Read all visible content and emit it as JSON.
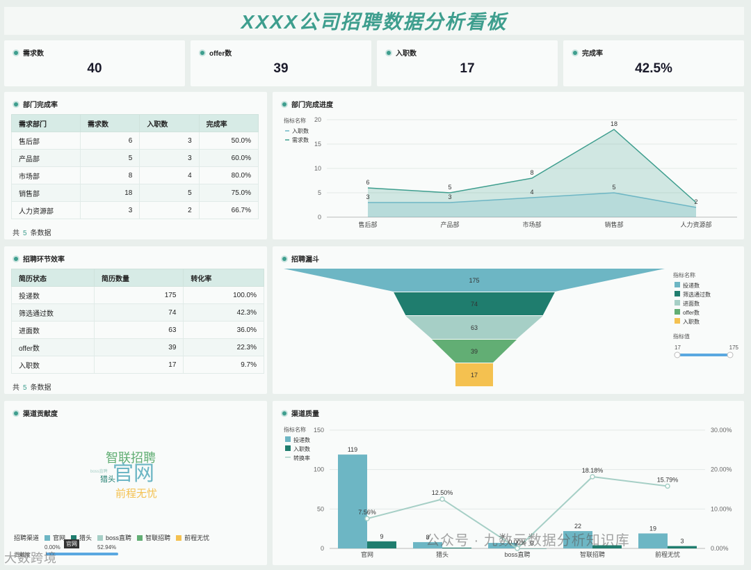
{
  "title": "XXXX公司招聘数据分析看板",
  "kpis": [
    {
      "label": "需求数",
      "value": "40"
    },
    {
      "label": "offer数",
      "value": "39"
    },
    {
      "label": "入职数",
      "value": "17"
    },
    {
      "label": "完成率",
      "value": "42.5%"
    }
  ],
  "dept_table": {
    "title": "部门完成率",
    "headers": [
      "需求部门",
      "需求数",
      "入职数",
      "完成率"
    ],
    "rows": [
      [
        "售后部",
        "6",
        "3",
        "50.0%"
      ],
      [
        "产品部",
        "5",
        "3",
        "60.0%"
      ],
      [
        "市场部",
        "8",
        "4",
        "80.0%"
      ],
      [
        "销售部",
        "18",
        "5",
        "75.0%"
      ],
      [
        "人力资源部",
        "3",
        "2",
        "66.7%"
      ]
    ],
    "footer_prefix": "共",
    "footer_count": "5",
    "footer_suffix": "条数据"
  },
  "stage_table": {
    "title": "招聘环节效率",
    "headers": [
      "简历状态",
      "简历数量",
      "转化率"
    ],
    "rows": [
      [
        "投递数",
        "175",
        "100.0%"
      ],
      [
        "筛选通过数",
        "74",
        "42.3%"
      ],
      [
        "进面数",
        "63",
        "36.0%"
      ],
      [
        "offer数",
        "39",
        "22.3%"
      ],
      [
        "入职数",
        "17",
        "9.7%"
      ]
    ],
    "footer_prefix": "共",
    "footer_count": "5",
    "footer_suffix": "条数据"
  },
  "progress": {
    "title": "部门完成进度",
    "legend_title": "指标名称"
  },
  "funnel": {
    "title": "招聘漏斗",
    "legend_title": "指标名称",
    "range_title": "指标值",
    "range_min": "17",
    "range_max": "175"
  },
  "channel": {
    "title": "渠道贡献度",
    "words": [
      "智联招聘",
      "官网",
      "猎头",
      "前程无忧",
      "boss直聘"
    ],
    "legend_title": "招聘渠道",
    "legend_items": [
      "官网",
      "猎头",
      "boss直聘",
      "智联招聘",
      "前程无忧"
    ],
    "legend_colors": [
      "#6db6c4",
      "#1f7d6e",
      "#a6cfc6",
      "#62ae74",
      "#f4c150"
    ],
    "tooltip_label": "官网",
    "range_left": "0.00%",
    "range_right": "52.94%",
    "range_label": "贡献度"
  },
  "quality": {
    "title": "渠道质量",
    "legend_title": "指标名称"
  },
  "watermark_left": "大数跨境",
  "watermark_right": "公众号 · 九数云数据分析知识库",
  "chart_data": [
    {
      "type": "area",
      "categories": [
        "售后部",
        "产品部",
        "市场部",
        "销售部",
        "人力资源部"
      ],
      "series": [
        {
          "name": "入职数",
          "values": [
            3,
            3,
            4,
            5,
            2
          ],
          "color": "#6db6c4"
        },
        {
          "name": "需求数",
          "values": [
            6,
            5,
            8,
            18,
            3
          ],
          "color": "#3e9e8e"
        }
      ],
      "ylim": [
        0,
        20
      ],
      "yticks": [
        "0",
        "5",
        "10",
        "15",
        "20"
      ],
      "point_labels": {
        "入职数": [
          "3",
          "3",
          "4",
          "5",
          "2"
        ],
        "需求数": [
          "6",
          "5",
          "8",
          "18",
          ""
        ]
      }
    },
    {
      "type": "funnel",
      "categories": [
        "投递数",
        "筛选通过数",
        "进面数",
        "offer数",
        "入职数"
      ],
      "values": [
        175,
        74,
        63,
        39,
        17
      ],
      "colors": [
        "#6db6c4",
        "#1f7d6e",
        "#a6cfc6",
        "#62ae74",
        "#f4c150"
      ]
    },
    {
      "type": "bar",
      "categories": [
        "官网",
        "猎头",
        "boss直聘",
        "智联招聘",
        "前程无忧"
      ],
      "series": [
        {
          "name": "投递数",
          "values": [
            119,
            8,
            7,
            22,
            19
          ],
          "color": "#6db6c4"
        },
        {
          "name": "入职数",
          "values": [
            9,
            1,
            0,
            4,
            3
          ],
          "color": "#1f7d6e"
        },
        {
          "name": "转换率",
          "values": [
            7.56,
            12.5,
            0.0,
            18.18,
            15.79
          ],
          "color": "#a6cfc6",
          "axis": "right"
        }
      ],
      "bar_labels": {
        "投递数": [
          "119",
          "8",
          "7",
          "22",
          "19"
        ],
        "入职数": [
          "9",
          "",
          "0",
          "",
          "3"
        ]
      },
      "rate_labels": [
        "7.56%",
        "12.50%",
        "0.00%",
        "18.18%",
        "15.79%"
      ],
      "ylim_left": [
        0,
        150
      ],
      "yticks_left": [
        "0",
        "50",
        "100",
        "150"
      ],
      "ylim_right": [
        0,
        30
      ],
      "yticks_right": [
        "0.00%",
        "10.00%",
        "20.00%",
        "30.00%"
      ]
    }
  ]
}
